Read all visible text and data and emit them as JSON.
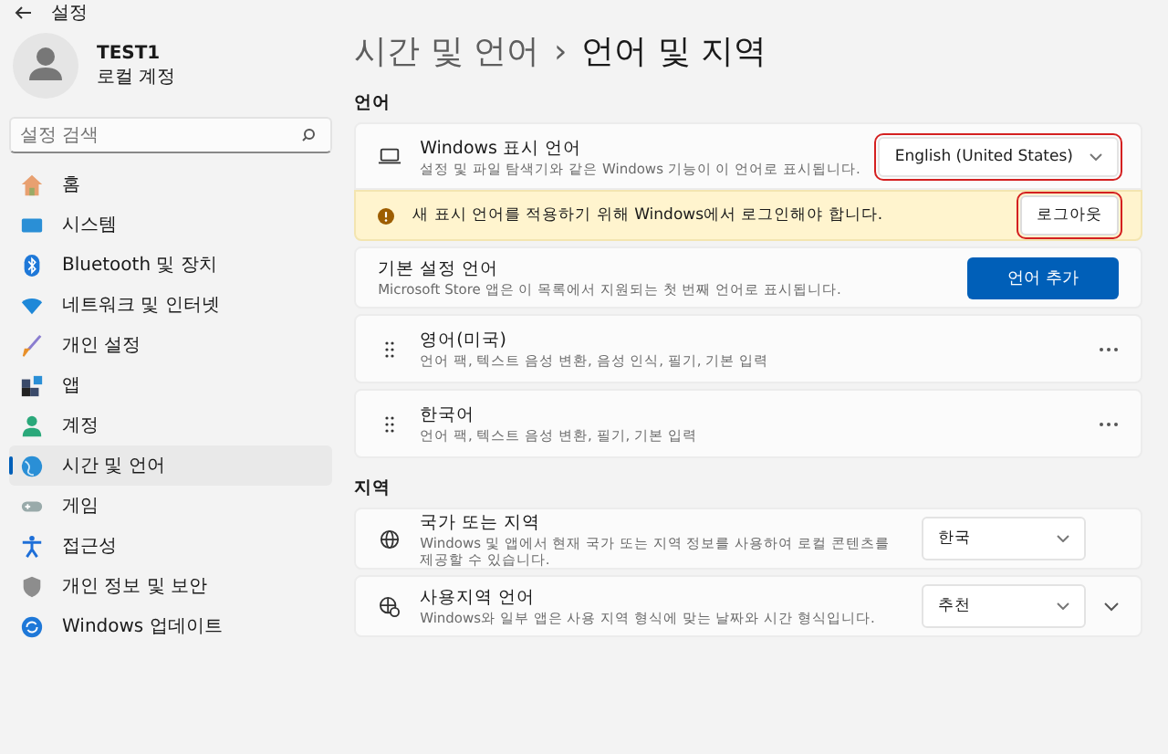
{
  "window": {
    "title": "설정"
  },
  "account": {
    "name": "TEST1",
    "type": "로컬 계정"
  },
  "search": {
    "placeholder": "설정 검색"
  },
  "sidebar": {
    "items": [
      {
        "label": "홈",
        "kind": "home",
        "selected": false
      },
      {
        "label": "시스템",
        "kind": "system",
        "selected": false
      },
      {
        "label": "Bluetooth 및 장치",
        "kind": "bluetooth",
        "selected": false
      },
      {
        "label": "네트워크 및 인터넷",
        "kind": "network",
        "selected": false
      },
      {
        "label": "개인 설정",
        "kind": "personalization",
        "selected": false
      },
      {
        "label": "앱",
        "kind": "apps",
        "selected": false
      },
      {
        "label": "계정",
        "kind": "accounts",
        "selected": false
      },
      {
        "label": "시간 및 언어",
        "kind": "time",
        "selected": true
      },
      {
        "label": "게임",
        "kind": "gaming",
        "selected": false
      },
      {
        "label": "접근성",
        "kind": "accessibility",
        "selected": false
      },
      {
        "label": "개인 정보 및 보안",
        "kind": "privacy",
        "selected": false
      },
      {
        "label": "Windows 업데이트",
        "kind": "update",
        "selected": false
      }
    ]
  },
  "breadcrumb": {
    "parent": "시간 및 언어",
    "separator": "›",
    "current": "언어 및 지역"
  },
  "language_section": {
    "heading": "언어",
    "display_language": {
      "title": "Windows 표시 언어",
      "description": "설정 및 파일 탐색기와 같은 Windows 기능이 이 언어로 표시됩니다.",
      "value": "English (United States)"
    },
    "notice": {
      "text": "새 표시 언어를 적용하기 위해 Windows에서 로그인해야 합니다.",
      "button": "로그아웃"
    },
    "preferred": {
      "title": "기본 설정 언어",
      "description": "Microsoft Store 앱은 이 목록에서 지원되는 첫 번째 언어로 표시됩니다.",
      "button": "언어 추가"
    },
    "languages": [
      {
        "name": "영어(미국)",
        "features": "언어 팩, 텍스트 음성 변환, 음성 인식, 필기, 기본 입력"
      },
      {
        "name": "한국어",
        "features": "언어 팩, 텍스트 음성 변환, 필기, 기본 입력"
      }
    ]
  },
  "region_section": {
    "heading": "지역",
    "rows": [
      {
        "kind": "country",
        "title": "국가 또는 지역",
        "description": "Windows 및 앱에서 현재 국가 또는 지역 정보를 사용하여 로컬 콘텐츠를 제공할 수 있습니다.",
        "value": "한국"
      },
      {
        "kind": "format",
        "title": "사용지역 언어",
        "description": "Windows와 일부 앱은 사용 지역 형식에 맞는 날짜와 시간 형식입니다.",
        "value": "추천"
      }
    ]
  }
}
